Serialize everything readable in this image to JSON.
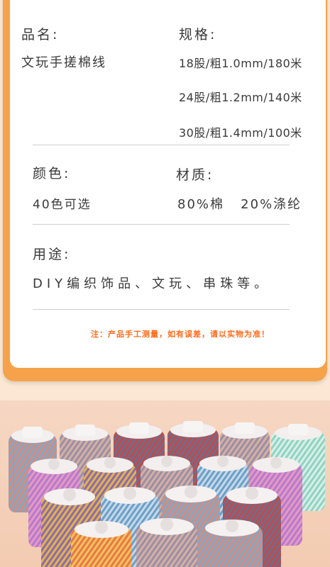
{
  "product_name": {
    "label": "品名:",
    "value": "文玩手搓棉线"
  },
  "spec": {
    "label": "规格:",
    "items": [
      "18股/粗1.0mm/180米",
      "24股/粗1.2mm/140米",
      "30股/粗1.4mm/100米"
    ]
  },
  "color": {
    "label": "颜色:",
    "value": "40色可选"
  },
  "material": {
    "label": "材质:",
    "value": "80%棉   20%涤纶"
  },
  "usage": {
    "label": "用途:",
    "value": "DIY编织饰品、文玩、串珠等。"
  },
  "note": "注：产品手工测量，如有误差，请以实物为准！",
  "colors": {
    "accent": "#f5a24a",
    "note": "#ff6a1a",
    "background": "#fbe7d3"
  },
  "photo": {
    "subject": "thread-spools"
  }
}
